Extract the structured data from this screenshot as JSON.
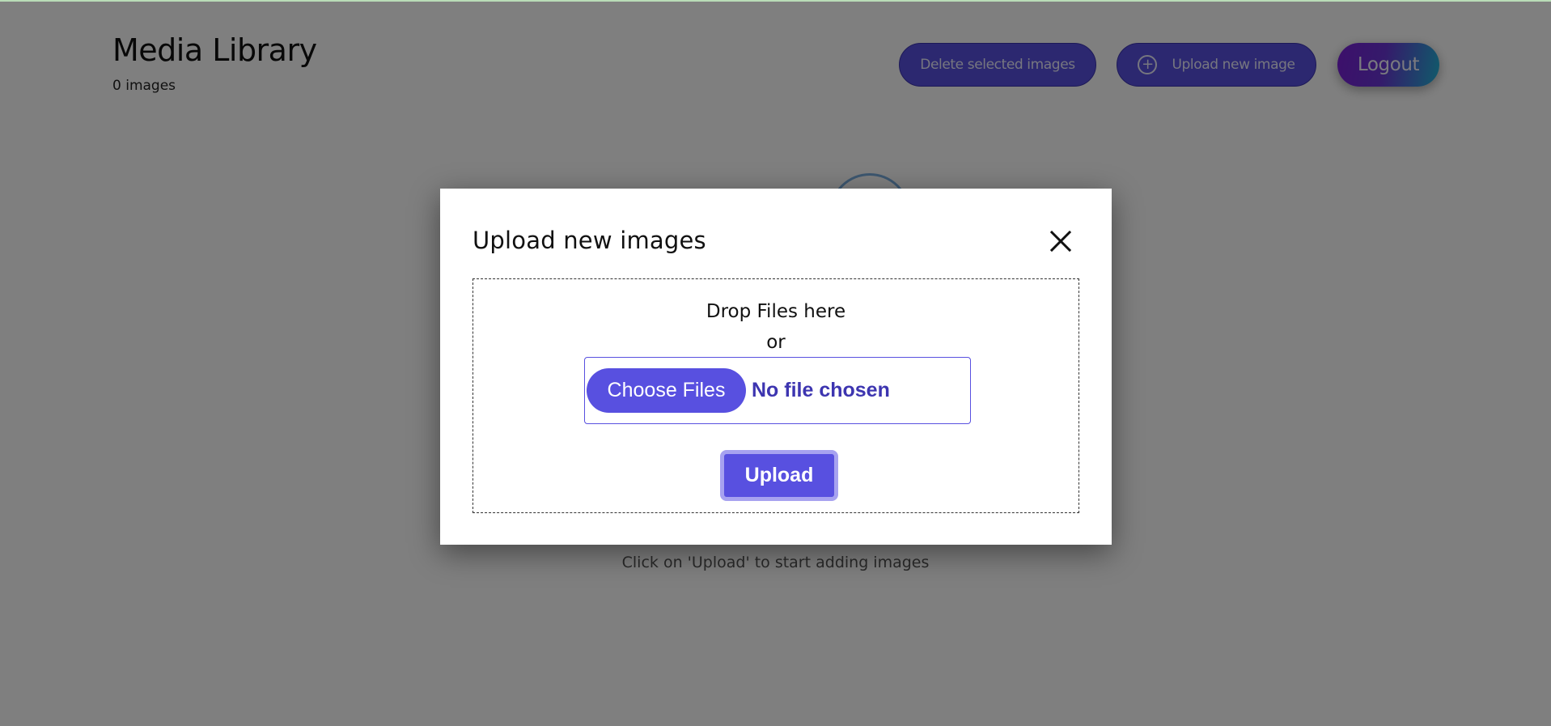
{
  "header": {
    "title": "Media Library",
    "image_count": "0 images",
    "delete_button": "Delete selected images",
    "upload_new_button": "Upload new image",
    "logout_button": "Logout"
  },
  "empty_state": {
    "hint": "Click on 'Upload' to start adding images"
  },
  "modal": {
    "title": "Upload new images",
    "close_icon": "close-icon",
    "dropzone": {
      "drop_text": "Drop Files here",
      "or_text": "or",
      "choose_button": "Choose Files",
      "file_status": "No file chosen"
    },
    "upload_button": "Upload"
  },
  "colors": {
    "primary": "#5850e0",
    "primary_dark": "#3d35b0",
    "overlay": "rgba(0,0,0,0.5)",
    "logout_gradient_start": "#7a1fd6",
    "logout_gradient_end": "#21b6d6"
  }
}
